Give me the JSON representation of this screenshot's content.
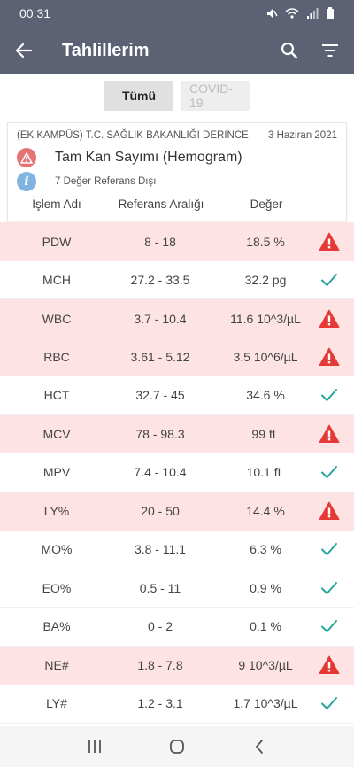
{
  "status_bar": {
    "time": "00:31"
  },
  "app_bar": {
    "title": "Tahlillerim"
  },
  "filters": {
    "all_label": "Tümü",
    "covid_label": "COVID-19"
  },
  "card": {
    "institution": "(EK KAMPÜS) T.C. SAĞLIK BAKANLIĞI DERINCE",
    "date": "3 Haziran 2021",
    "test_name": "Tam Kan Sayımı (Hemogram)",
    "out_of_range_text": "7 Değer Referans Dışı",
    "info_icon_letter": "i"
  },
  "table": {
    "headers": {
      "name": "İşlem Adı",
      "range": "Referans Aralığı",
      "value": "Değer"
    },
    "rows": [
      {
        "name": "PDW",
        "range": "8 - 18",
        "value": "18.5 %",
        "status": "alert"
      },
      {
        "name": "MCH",
        "range": "27.2 - 33.5",
        "value": "32.2 pg",
        "status": "ok"
      },
      {
        "name": "WBC",
        "range": "3.7 - 10.4",
        "value": "11.6 10^3/µL",
        "status": "alert"
      },
      {
        "name": "RBC",
        "range": "3.61 - 5.12",
        "value": "3.5 10^6/µL",
        "status": "alert"
      },
      {
        "name": "HCT",
        "range": "32.7 - 45",
        "value": "34.6 %",
        "status": "ok"
      },
      {
        "name": "MCV",
        "range": "78 - 98.3",
        "value": "99 fL",
        "status": "alert"
      },
      {
        "name": "MPV",
        "range": "7.4 - 10.4",
        "value": "10.1 fL",
        "status": "ok"
      },
      {
        "name": "LY%",
        "range": "20 - 50",
        "value": "14.4 %",
        "status": "alert"
      },
      {
        "name": "MO%",
        "range": "3.8 - 11.1",
        "value": "6.3 %",
        "status": "ok"
      },
      {
        "name": "EO%",
        "range": "0.5 - 11",
        "value": "0.9 %",
        "status": "ok"
      },
      {
        "name": "BA%",
        "range": "0 - 2",
        "value": "0.1 %",
        "status": "ok"
      },
      {
        "name": "NE#",
        "range": "1.8 - 7.8",
        "value": "9 10^3/µL",
        "status": "alert"
      },
      {
        "name": "LY#",
        "range": "1.2 - 3.1",
        "value": "1.7 10^3/µL",
        "status": "ok"
      }
    ]
  },
  "colors": {
    "app_bar": "#5c6173",
    "alert_row": "#fde3e4",
    "warning_icon": "#e53935",
    "check_icon": "#26a69a",
    "info_icon": "#7fb3e0"
  }
}
